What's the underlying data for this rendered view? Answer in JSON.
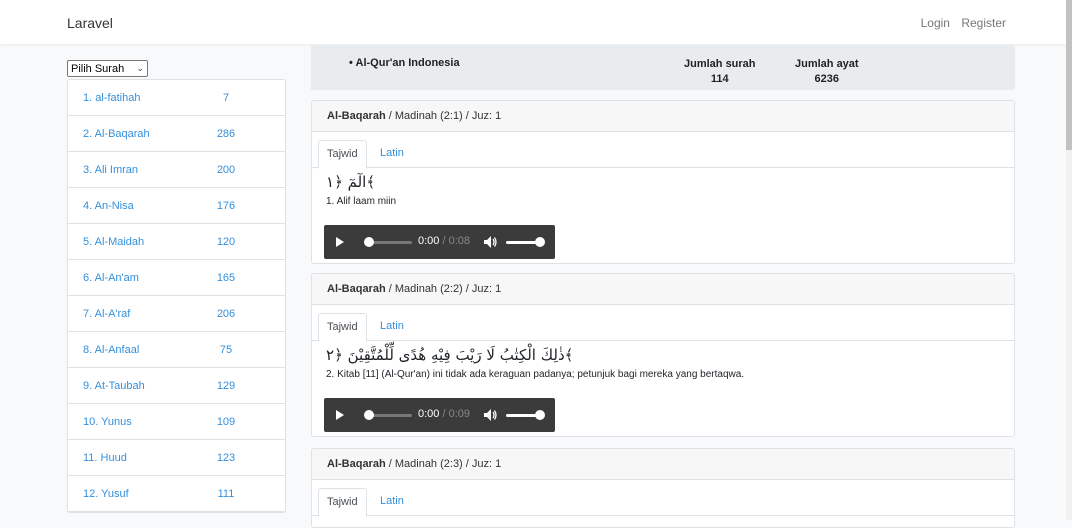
{
  "navbar": {
    "brand": "Laravel",
    "login": "Login",
    "register": "Register"
  },
  "sidebar": {
    "select_label": "Pilih Surah",
    "surahs": [
      {
        "name": "1. al-fatihah",
        "count": "7"
      },
      {
        "name": "2. Al-Baqarah",
        "count": "286"
      },
      {
        "name": "3. Ali Imran",
        "count": "200"
      },
      {
        "name": "4. An-Nisa",
        "count": "176"
      },
      {
        "name": "5. Al-Maidah",
        "count": "120"
      },
      {
        "name": "6. Al-An'am",
        "count": "165"
      },
      {
        "name": "7. Al-A'raf",
        "count": "206"
      },
      {
        "name": "8. Al-Anfaal",
        "count": "75"
      },
      {
        "name": "9. At-Taubah",
        "count": "129"
      },
      {
        "name": "10. Yunus",
        "count": "109"
      },
      {
        "name": "11. Huud",
        "count": "123"
      },
      {
        "name": "12. Yusuf",
        "count": "111"
      }
    ]
  },
  "info": {
    "title": "• Al-Qur'an Indonesia",
    "jumlah_surah_label": "Jumlah surah",
    "jumlah_surah_value": "114",
    "jumlah_ayat_label": "Jumlah ayat",
    "jumlah_ayat_value": "6236"
  },
  "ayat": [
    {
      "surah": "Al-Baqarah",
      "meta": " / Madinah (2:1) / Juz: 1",
      "tab_tajwid": "Tajwid",
      "tab_latin": "Latin",
      "arabic": "الٓمٓ ﴿١﴾",
      "translation": "1. Alif laam miin",
      "time_current": "0:00",
      "time_duration": " / 0:08"
    },
    {
      "surah": "Al-Baqarah",
      "meta": " / Madinah (2:2) / Juz: 1",
      "tab_tajwid": "Tajwid",
      "tab_latin": "Latin",
      "arabic": "ذٰلِكَ الْكِتٰبُ لَا رَيْبَ فِيْهِ هُدًى لِّلْمُتَّقِيْنَ ﴿٢﴾",
      "translation": "2. Kitab [11] (Al-Qur'an) ini tidak ada keraguan padanya; petunjuk bagi mereka yang bertaqwa.",
      "time_current": "0:00",
      "time_duration": " / 0:09"
    },
    {
      "surah": "Al-Baqarah",
      "meta": " / Madinah (2:3) / Juz: 1",
      "tab_tajwid": "Tajwid",
      "tab_latin": "Latin"
    }
  ]
}
